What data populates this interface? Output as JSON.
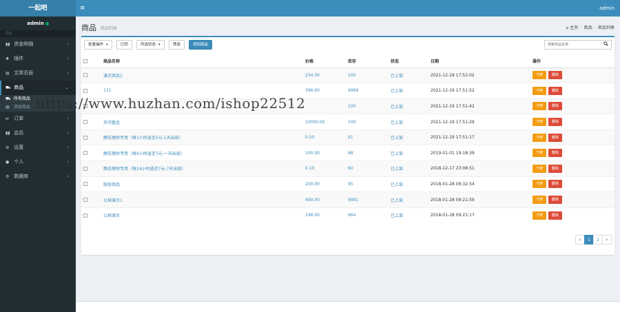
{
  "app": {
    "logo": "一起吧",
    "menu_toggle": "≡",
    "top_user": "admin"
  },
  "sidebar": {
    "user": "admin",
    "nav_header": "导航",
    "items": [
      {
        "label": "资金明细",
        "icon": "▮▮"
      },
      {
        "label": "插件",
        "icon": "♣"
      },
      {
        "label": "文章页面",
        "icon": "▤"
      },
      {
        "label": "商品",
        "icon": "⛟"
      },
      {
        "label": "订单",
        "icon": "⇄"
      },
      {
        "label": "会员",
        "icon": "▮▮"
      },
      {
        "label": "设置",
        "icon": "⚙"
      },
      {
        "label": "个人",
        "icon": "●"
      },
      {
        "label": "数据库",
        "icon": "⚙"
      }
    ],
    "sub_items": [
      {
        "label": "所有商品",
        "icon": "⛟"
      },
      {
        "label": "添加商品",
        "icon": "▦"
      }
    ],
    "chevron_right": "‹",
    "chevron_down": "⌄"
  },
  "header": {
    "title": "商品",
    "subtitle": "商品列表",
    "breadcrumb": [
      "主页",
      "商品",
      "商品列表"
    ],
    "home_icon": "⌂",
    "sep": "›"
  },
  "toolbar": {
    "bulk_label": "批量操作",
    "ok_label": "已同",
    "status_filter_label": "所选状态",
    "filter_label": "筛选",
    "add_label": "添加商品",
    "caret": "▾",
    "search_placeholder": "搜索商品名称",
    "search_icon": "🔍"
  },
  "table": {
    "columns": [
      "商品名称",
      "价格",
      "库存",
      "状态",
      "日期",
      "操作"
    ],
    "off_label": "下架",
    "delete_label": "删除",
    "rows": [
      {
        "name": "演示商品1",
        "price": "234.00",
        "stock": "100",
        "status": "已上架",
        "date": "2021-12-19 17:52:02"
      },
      {
        "name": "111",
        "price": "396.00",
        "stock": "9999",
        "status": "已上架",
        "date": "2021-12-19 17:51:52"
      },
      {
        "name": "",
        "price": "",
        "stock": "100",
        "status": "已上架",
        "date": "2021-12-19 17:51:42"
      },
      {
        "name": "天河基金",
        "price": "10000.00",
        "stock": "100",
        "status": "已上架",
        "date": "2021-12-19 17:51:29"
      },
      {
        "name": "静态理财专用（每1小时返还2元-1天出局）",
        "price": "0.50",
        "stock": "91",
        "status": "已上架",
        "date": "2021-12-19 17:51:17"
      },
      {
        "name": "静态理财专用（每6小时返还7元-一天出局）",
        "price": "100.00",
        "stock": "88",
        "status": "已上架",
        "date": "2019-01-01 19:18:39"
      },
      {
        "name": "静态理财专用（每24小时返还7元-7天出局）",
        "price": "0.10",
        "stock": "60",
        "status": "已上架",
        "date": "2018-12-17 23:08:51"
      },
      {
        "name": "股权商品",
        "price": "200.00",
        "stock": "95",
        "status": "已上架",
        "date": "2018-01-28 09:32:54"
      },
      {
        "name": "公排演示1",
        "price": "499.00",
        "stock": "9991",
        "status": "已上架",
        "date": "2018-01-28 09:21:59"
      },
      {
        "name": "公排演示",
        "price": "198.00",
        "stock": "964",
        "status": "已上架",
        "date": "2018-01-28 09:21:17"
      }
    ]
  },
  "pagination": {
    "prev": "«",
    "pages": [
      "1",
      "2"
    ],
    "next": "»"
  },
  "watermark": "https://www.huzhan.com/ishop22512"
}
